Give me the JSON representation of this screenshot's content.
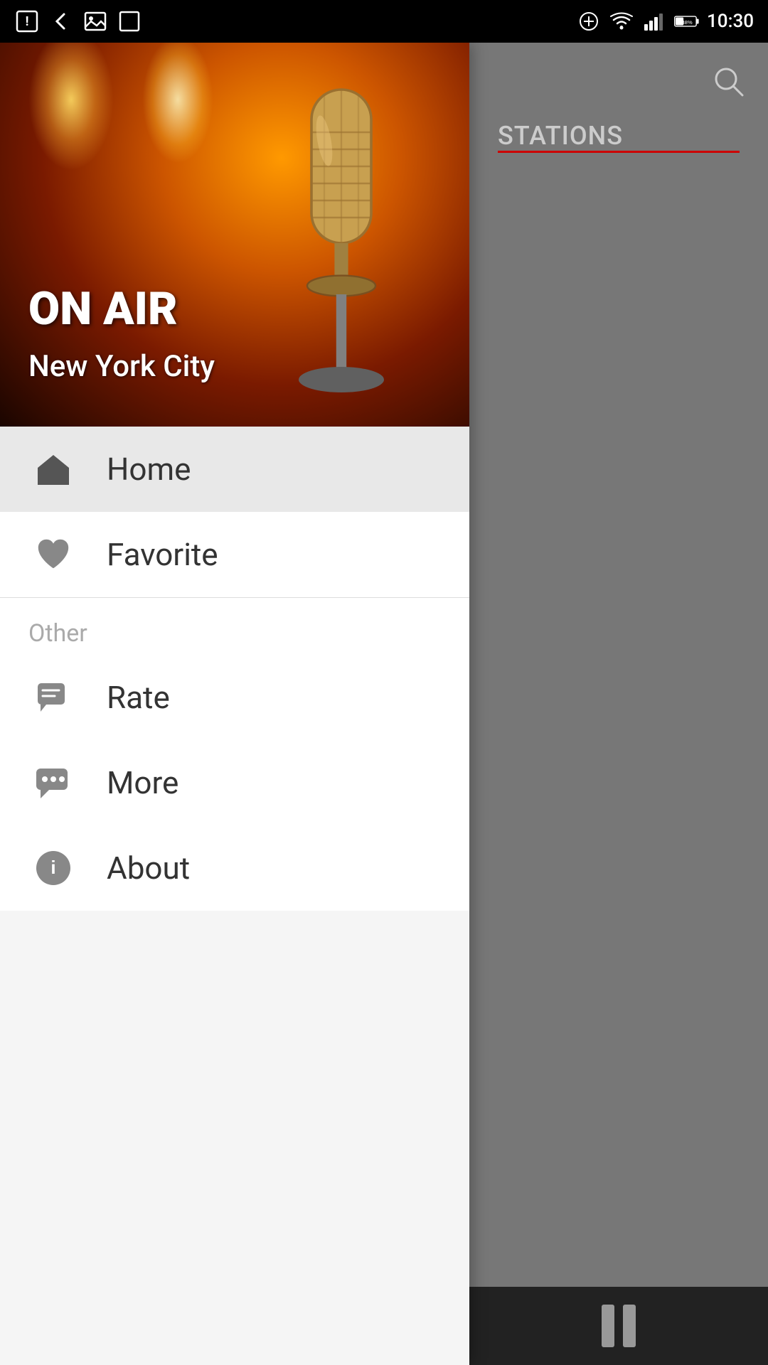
{
  "statusBar": {
    "time": "10:30",
    "batteryPercent": "38%"
  },
  "hero": {
    "onAirText": "ON\nAIR",
    "cityText": "New York City"
  },
  "nav": {
    "homeLabel": "Home",
    "favoriteLabel": "Favorite",
    "sectionOtherLabel": "Other",
    "rateLabel": "Rate",
    "moreLabel": "More",
    "aboutLabel": "About"
  },
  "content": {
    "stationsTabLabel": "STATIONS",
    "searchIconName": "search-icon"
  },
  "colors": {
    "accent": "#cc0000",
    "navHighlight": "#e8e8e8"
  }
}
